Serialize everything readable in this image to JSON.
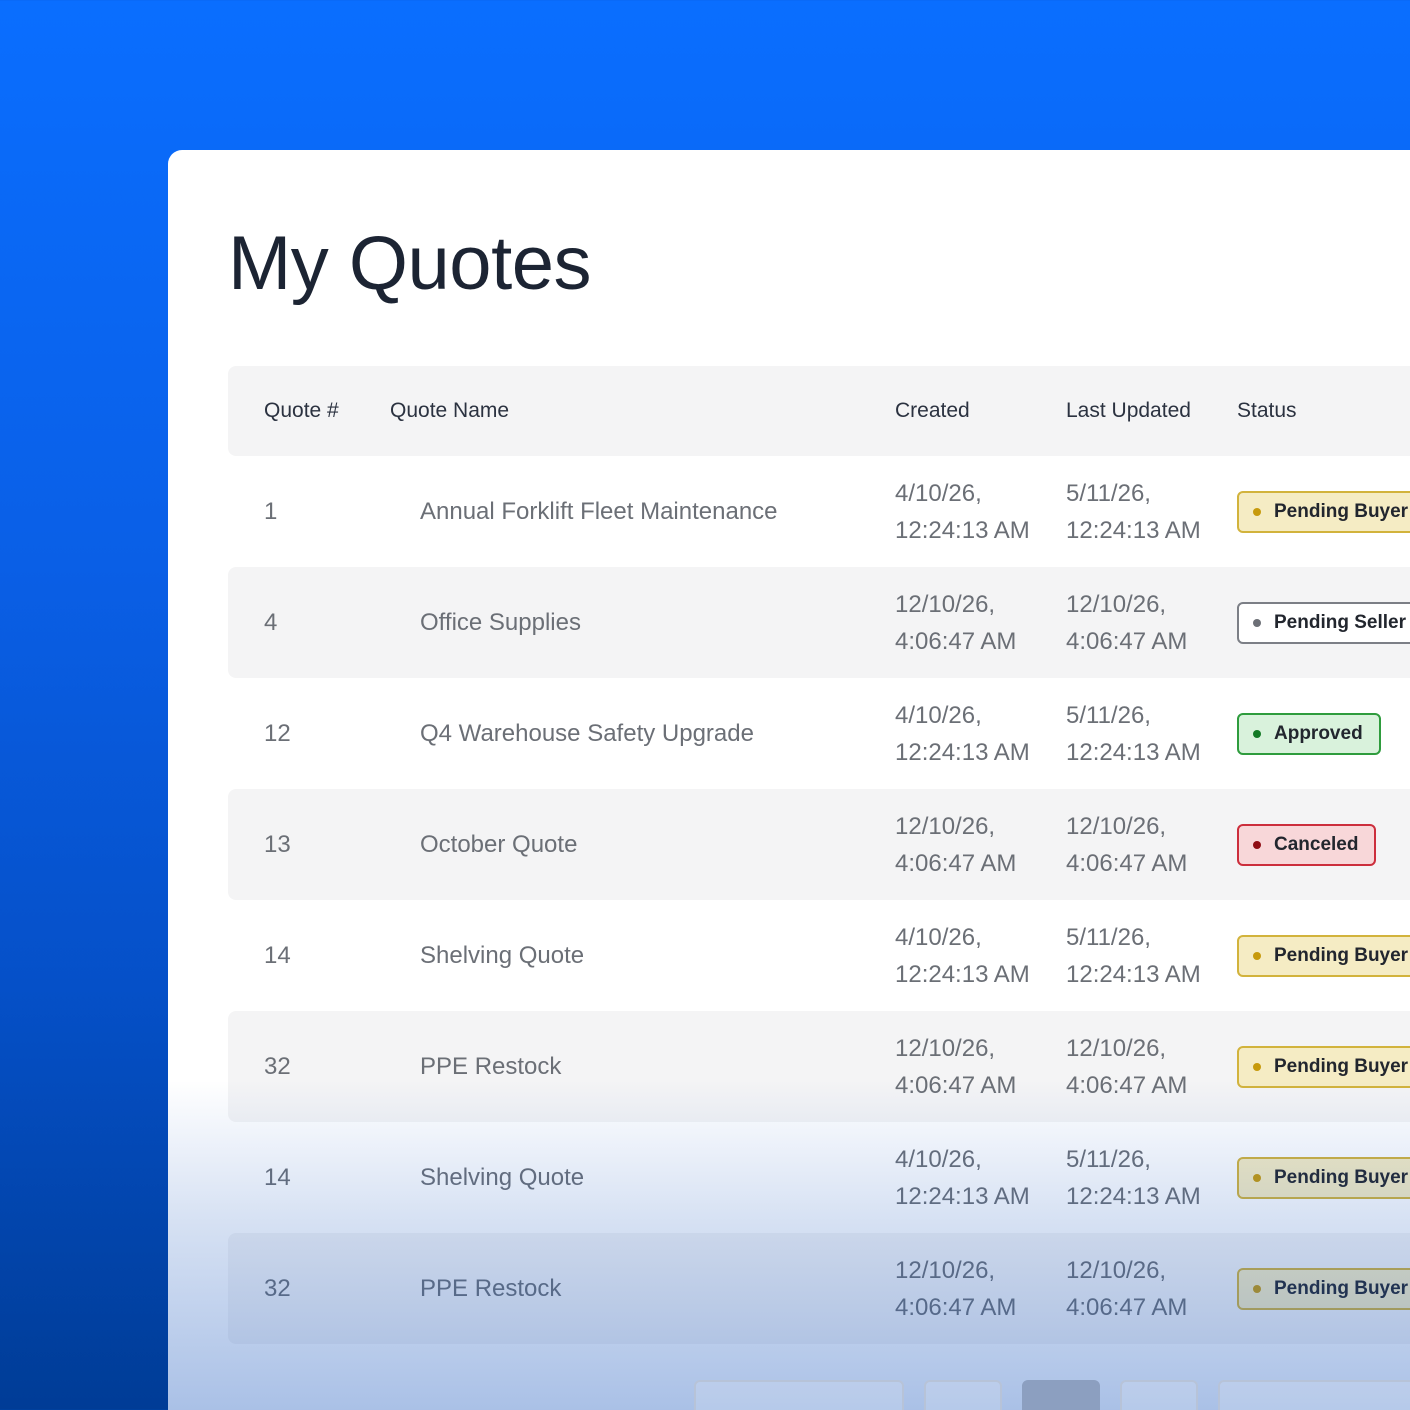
{
  "page": {
    "title": "My Quotes"
  },
  "table": {
    "headers": {
      "num": "Quote #",
      "name": "Quote Name",
      "created": "Created",
      "updated": "Last Updated",
      "status": "Status"
    },
    "rows": [
      {
        "num": "1",
        "name": "Annual Forklift Fleet Maintenance",
        "created_date": "4/10/26,",
        "created_time": "12:24:13 AM",
        "updated_date": "5/11/26,",
        "updated_time": "12:24:13 AM",
        "status": "Pending Buyer Review",
        "status_kind": "pending-buyer"
      },
      {
        "num": "4",
        "name": "Office Supplies",
        "created_date": "12/10/26,",
        "created_time": "4:06:47 AM",
        "updated_date": "12/10/26,",
        "updated_time": "4:06:47 AM",
        "status": "Pending Seller Review",
        "status_kind": "pending-seller"
      },
      {
        "num": "12",
        "name": "Q4 Warehouse Safety Upgrade",
        "created_date": "4/10/26,",
        "created_time": "12:24:13 AM",
        "updated_date": "5/11/26,",
        "updated_time": "12:24:13 AM",
        "status": "Approved",
        "status_kind": "approved"
      },
      {
        "num": "13",
        "name": "October Quote",
        "created_date": "12/10/26,",
        "created_time": "4:06:47 AM",
        "updated_date": "12/10/26,",
        "updated_time": "4:06:47 AM",
        "status": "Canceled",
        "status_kind": "canceled"
      },
      {
        "num": "14",
        "name": "Shelving Quote",
        "created_date": "4/10/26,",
        "created_time": "12:24:13 AM",
        "updated_date": "5/11/26,",
        "updated_time": "12:24:13 AM",
        "status": "Pending Buyer Review",
        "status_kind": "pending-buyer"
      },
      {
        "num": "32",
        "name": "PPE Restock",
        "created_date": "12/10/26,",
        "created_time": "4:06:47 AM",
        "updated_date": "12/10/26,",
        "updated_time": "4:06:47 AM",
        "status": "Pending Buyer Review",
        "status_kind": "pending-buyer"
      },
      {
        "num": "14",
        "name": "Shelving Quote",
        "created_date": "4/10/26,",
        "created_time": "12:24:13 AM",
        "updated_date": "5/11/26,",
        "updated_time": "12:24:13 AM",
        "status": "Pending Buyer Review",
        "status_kind": "pending-buyer"
      },
      {
        "num": "32",
        "name": "PPE Restock",
        "created_date": "12/10/26,",
        "created_time": "4:06:47 AM",
        "updated_date": "12/10/26,",
        "updated_time": "4:06:47 AM",
        "status": "Pending Buyer Review",
        "status_kind": "pending-buyer"
      }
    ]
  },
  "colors": {
    "background": "#0a6eff",
    "title": "#1c2433",
    "pending_buyer": "#d2b33c",
    "pending_seller": "#7c7f86",
    "approved": "#2e9c3d",
    "canceled": "#cc2e3c"
  }
}
